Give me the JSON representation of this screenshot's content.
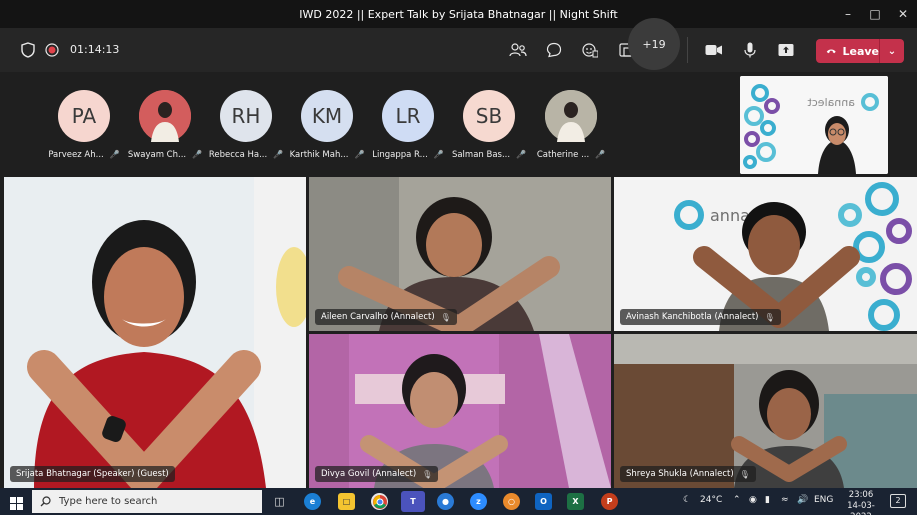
{
  "window": {
    "title": "IWD 2022 || Expert Talk by Srijata Bhatnagar || Night Shift"
  },
  "controls": {
    "timer": "01:14:13",
    "leave_label": "Leave"
  },
  "roster": [
    {
      "initials": "PA",
      "name": "Parveez Ah...",
      "color": "#f6d6cf",
      "photo": false
    },
    {
      "initials": "",
      "name": "Swayam Ch...",
      "color": "#d35d5d",
      "photo": true
    },
    {
      "initials": "RH",
      "name": "Rebecca Ha...",
      "color": "#dfe4ec",
      "photo": false
    },
    {
      "initials": "KM",
      "name": "Karthik Mah...",
      "color": "#d5dff0",
      "photo": false
    },
    {
      "initials": "LR",
      "name": "Lingappa R...",
      "color": "#cfdcf4",
      "photo": false
    },
    {
      "initials": "SB",
      "name": "Salman Bas...",
      "color": "#f6d9d0",
      "photo": false
    },
    {
      "initials": "",
      "name": "Catherine ...",
      "color": "#b8b4a6",
      "photo": true
    }
  ],
  "more_participants": "+19",
  "selfview": {
    "brand": "annalect"
  },
  "tiles": [
    {
      "label": "Srijata Bhatnagar (Speaker) (Guest)"
    },
    {
      "label": "Aileen Carvalho (Annalect)"
    },
    {
      "label": "Avinash Kanchibotla (Annalect)"
    },
    {
      "label": "Divya Govil (Annalect)"
    },
    {
      "label": "Shreya Shukla (Annalect)"
    }
  ],
  "tile_brand": "anna",
  "taskbar": {
    "search_placeholder": "Type here to search",
    "temperature": "24°C",
    "language": "ENG",
    "time": "23:06",
    "date": "14-03-2022",
    "notifications": "2"
  }
}
